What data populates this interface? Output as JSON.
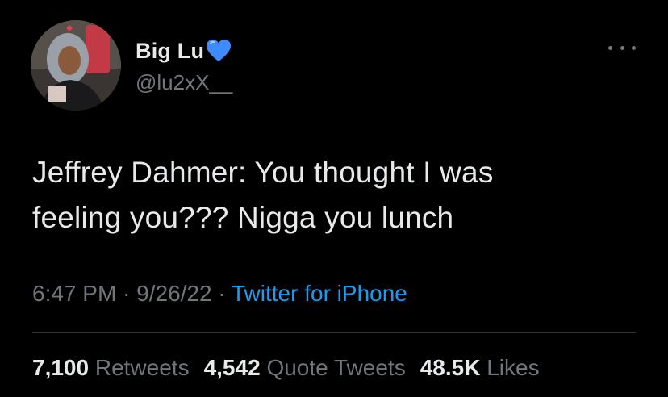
{
  "author": {
    "display_name": "Big Lu",
    "handle": "@lu2xX__",
    "emoji": "blue-heart-emoji"
  },
  "tweet": {
    "line1": "Jeffrey Dahmer: You thought I was",
    "line2": "feeling you??? Nigga you lunch"
  },
  "meta": {
    "time": "6:47 PM",
    "separator": "·",
    "date": "9/26/22",
    "source": "Twitter for iPhone"
  },
  "stats": {
    "retweets_count": "7,100",
    "retweets_label": "Retweets",
    "quotes_count": "4,542",
    "quotes_label": "Quote Tweets",
    "likes_count": "48.5K",
    "likes_label": "Likes"
  },
  "colors": {
    "background": "#000000",
    "text": "#e7e9ea",
    "secondary": "#71767b",
    "link": "#1d9bf0",
    "heart": "#3d8bff"
  }
}
